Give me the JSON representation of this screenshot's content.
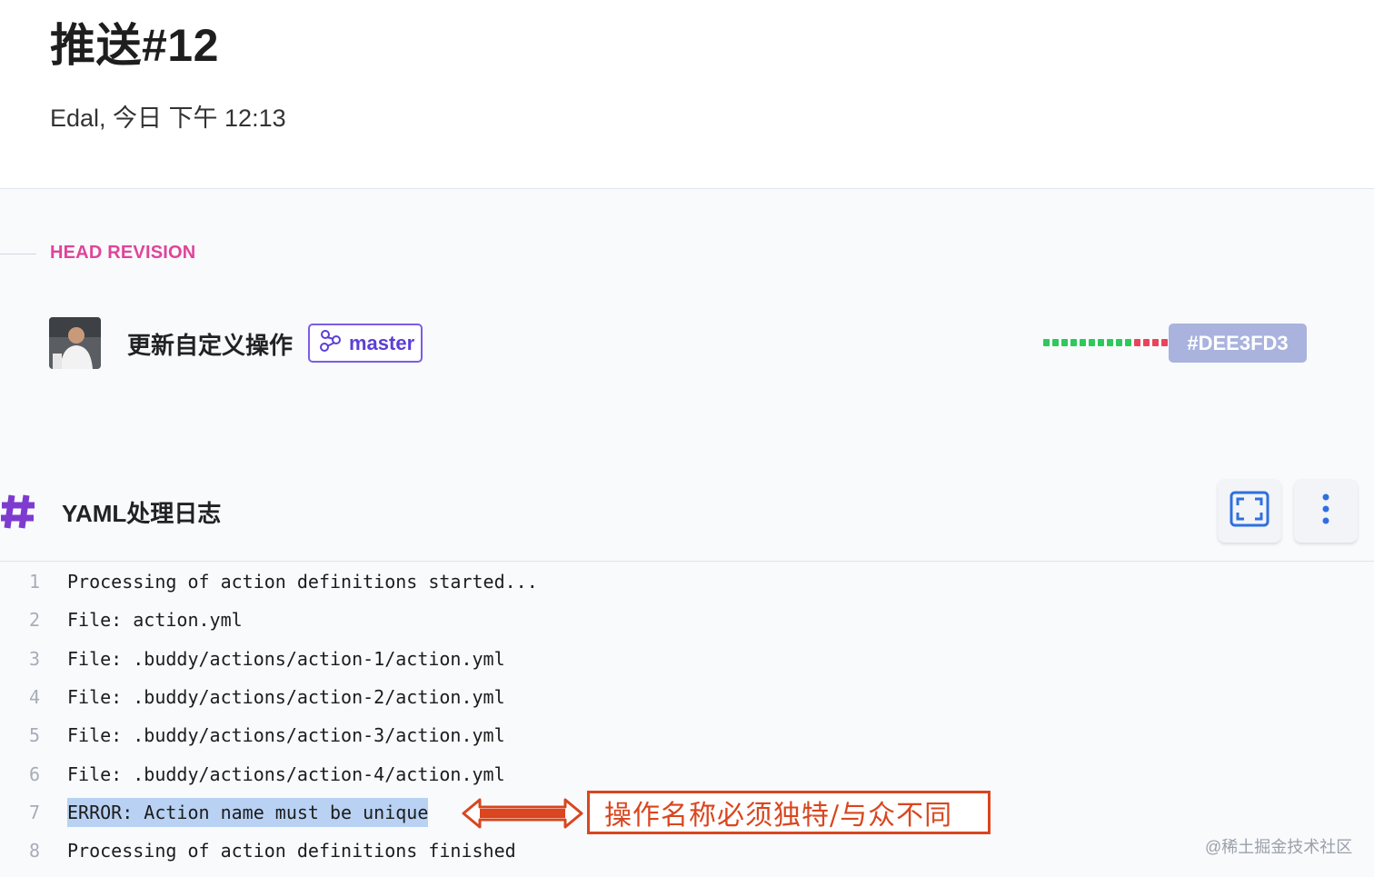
{
  "header": {
    "title": "推送#12",
    "subtitle": "Edal, 今日 下午 12:13"
  },
  "head_revision": {
    "label": "HEAD REVISION",
    "commit_message": "更新自定义操作",
    "branch": "master",
    "revision": "#DEE3FD3",
    "dot_colors": [
      "#2ec95c",
      "#2ec95c",
      "#2ec95c",
      "#2ec95c",
      "#2ec95c",
      "#2ec95c",
      "#2ec95c",
      "#2ec95c",
      "#2ec95c",
      "#2ec95c",
      "#e8445a",
      "#e8445a",
      "#e8445a",
      "#e8445a",
      "#e8445a",
      "#e8445a"
    ]
  },
  "log": {
    "title": "YAML处理日志",
    "lines": [
      {
        "n": "1",
        "text": "Processing of action definitions started..."
      },
      {
        "n": "2",
        "text": "File: action.yml"
      },
      {
        "n": "3",
        "text": "File: .buddy/actions/action-1/action.yml"
      },
      {
        "n": "4",
        "text": "File: .buddy/actions/action-2/action.yml"
      },
      {
        "n": "5",
        "text": "File: .buddy/actions/action-3/action.yml"
      },
      {
        "n": "6",
        "text": "File: .buddy/actions/action-4/action.yml"
      },
      {
        "n": "7",
        "text": "ERROR: Action name must be unique"
      },
      {
        "n": "8",
        "text": "Processing of action definitions finished"
      }
    ]
  },
  "annotation": {
    "text": "操作名称必须独特/与众不同"
  },
  "watermark": "@稀土掘金技术社区",
  "colors": {
    "accent_pink": "#e0449a",
    "branch_purple": "#7d5be6",
    "revision_badge": "#a9b3dd",
    "annotation_red": "#d9461f",
    "highlight": "#b9d2f3",
    "icon_blue": "#2f6fe0"
  },
  "icons": {
    "branch": "git-branch-icon",
    "hash": "hash-icon",
    "fullscreen": "fullscreen-icon",
    "more": "more-vertical-icon"
  }
}
